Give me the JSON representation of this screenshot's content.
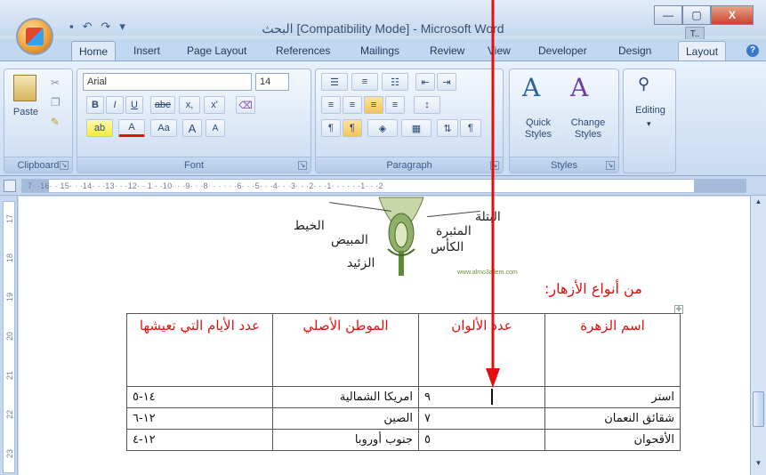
{
  "window": {
    "title": "البحث [Compatibility Mode] - Microsoft Word",
    "user_badge": "T..",
    "min_label": "—",
    "max_label": "▢",
    "close_label": "X"
  },
  "tabs": [
    "Home",
    "Insert",
    "Page Layout",
    "References",
    "Mailings",
    "Review",
    "View",
    "Developer",
    "Design",
    "Layout"
  ],
  "ribbon": {
    "clipboard": {
      "label": "Clipboard",
      "paste": "Paste"
    },
    "font": {
      "label": "Font",
      "family": "Arial",
      "size": "14",
      "bold": "B",
      "italic": "I",
      "underline": "U",
      "strike": "abe",
      "sub": "x,",
      "sup": "x'",
      "clear": "Aa",
      "grow": "A",
      "shrink": "A"
    },
    "paragraph": {
      "label": "Paragraph"
    },
    "styles": {
      "label": "Styles",
      "quick": "Quick Styles",
      "change": "Change Styles"
    },
    "editing": {
      "label": "Editing",
      "text": "Editing"
    }
  },
  "ruler": {
    "numbers": "7· ·16· · 15· · ·14· · ·13· · ·12· · 1 · ·10· · ·9· · ·8· · · · · ·6· · ·5· · ·4· · ·3· · ·2· · ·1· · · · · ·1· · ·2"
  },
  "vruler_numbers": [
    "17",
    "18",
    "19",
    "20",
    "21",
    "22",
    "23"
  ],
  "diagram": {
    "labels": [
      "الخيط",
      "المبيض",
      "الزئيد",
      "الكأس",
      "البتلة",
      "المئبرة"
    ],
    "watermark": "www.almo3allem.com"
  },
  "heading": "من أنواع الأزهار:",
  "table": {
    "headers": [
      "اسم الزهرة",
      "عدد الألوان",
      "الموطن الأصلي",
      "عدد الأيام التي تعيشها"
    ],
    "rows": [
      [
        "استر",
        "٩",
        "امريكا الشمالية",
        "١٤-٥"
      ],
      [
        "شقائق النعمان",
        "٧",
        "الصين",
        "١٢-٦"
      ],
      [
        "الأقحوان",
        "٥",
        "جنوب أوروبا",
        "١٢-٤"
      ]
    ]
  },
  "colors": {
    "accent": "#e01010",
    "ribbon": "#cfdff2"
  }
}
